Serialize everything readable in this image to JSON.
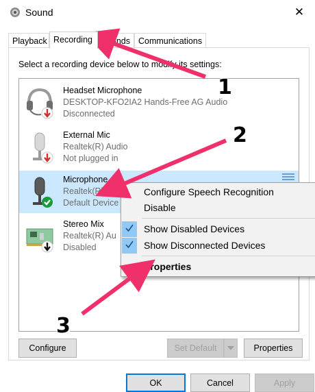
{
  "window": {
    "title": "Sound",
    "close_glyph": "✕"
  },
  "tabs": [
    {
      "label": "Playback"
    },
    {
      "label": "Recording",
      "active": true
    },
    {
      "label": "Sounds",
      "visible_text": "unds"
    },
    {
      "label": "Communications"
    }
  ],
  "instruction": "Select a recording device below to modify its settings:",
  "devices": [
    {
      "name": "Headset Microphone",
      "line2": "DESKTOP-KFO2IA2 Hands-Free AG Audio",
      "line3": "Disconnected",
      "status_icon": "red-down-arrow-icon"
    },
    {
      "name": "External Mic",
      "line2": "Realtek(R) Audio",
      "line3": "Not plugged in",
      "status_icon": "red-down-arrow-icon"
    },
    {
      "name": "Microphone",
      "line2": "Realtek(R) Audio",
      "line2_visible": "Realtek(R) Au",
      "line3": "Default Device",
      "line3_visible": "Default Device",
      "status_icon": "green-check-icon",
      "selected": true
    },
    {
      "name": "Stereo Mix",
      "line2": "Realtek(R) Aud",
      "line2_visible": "Realtek(R) Au",
      "line3": "Disabled",
      "status_icon": "black-down-arrow-icon"
    }
  ],
  "context_menu": {
    "items": [
      {
        "label": "Configure Speech Recognition",
        "checked": false
      },
      {
        "label": "Disable",
        "checked": false
      },
      {
        "label": "Show Disabled Devices",
        "checked": true
      },
      {
        "label": "Show Disconnected Devices",
        "checked": true
      },
      {
        "label": "Properties",
        "bold": true
      }
    ]
  },
  "buttons": {
    "configure": "Configure",
    "set_default": "Set Default",
    "properties": "Properties",
    "ok": "OK",
    "cancel": "Cancel",
    "apply": "Apply"
  },
  "annotations": {
    "step1": "1",
    "step2": "2",
    "step3": "3"
  },
  "colors": {
    "arrow": "#f0306a",
    "selection": "#cce8ff",
    "accent": "#0078d7",
    "check_bg": "#90c8f6"
  }
}
